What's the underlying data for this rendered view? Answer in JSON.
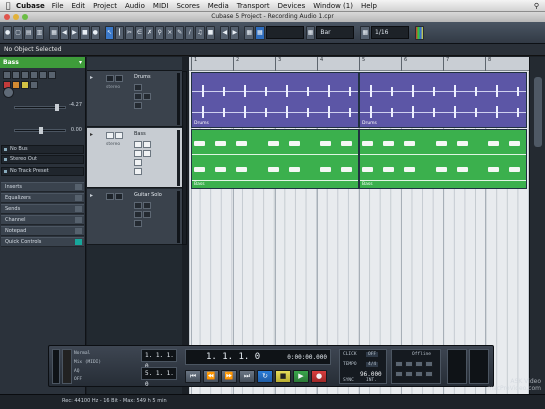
{
  "menubar": {
    "app_name": "Cubase",
    "items": [
      "File",
      "Edit",
      "Project",
      "Audio",
      "MIDI",
      "Scores",
      "Media",
      "Transport",
      "Devices",
      "Window (1)",
      "Help"
    ]
  },
  "window": {
    "title": "Cubase 5 Project - Recording Audio 1.cpr"
  },
  "toolbar": {
    "field_1": "Bar",
    "field_2": "1/16"
  },
  "statusline": {
    "text": "No Object Selected"
  },
  "inspector": {
    "track_name": "Bass",
    "volume": "-4.27",
    "pan": "0.00",
    "input_routing": "No Bus",
    "output_routing": "Stereo Out",
    "track_preset": "No Track Preset",
    "sections": [
      "Inserts",
      "Equalizers",
      "Sends",
      "Channel",
      "Notepad",
      "Quick Controls"
    ]
  },
  "tracks": [
    {
      "name": "Drums",
      "sub": "stereo"
    },
    {
      "name": "Bass",
      "sub": "stereo"
    },
    {
      "name": "Guitar Solo",
      "sub": ""
    }
  ],
  "ruler": {
    "bars": [
      "1",
      "2",
      "3",
      "4",
      "5",
      "6",
      "7",
      "8"
    ]
  },
  "events": [
    {
      "label": "Drums"
    },
    {
      "label": "Drums"
    },
    {
      "label": "Bass"
    },
    {
      "label": "Bass"
    }
  ],
  "transport": {
    "mode_1": "Normal",
    "mode_2": "Mix (MIDI)",
    "mode_3": "AQ",
    "mode_4": "OFF",
    "left_locator": "1. 1. 1. 0",
    "right_locator": "5. 1. 1. 0",
    "position_primary": "1. 1. 1.   0",
    "position_secondary": "0:00:00.000",
    "tempo_label": "TEMPO",
    "tempo_value": "96.000",
    "signature_value": "4/4",
    "sync_label": "SYNC",
    "sync_value": "INT.",
    "offline": "Offline",
    "click_label": "CLICK",
    "click_value": "OFF"
  },
  "bottom": {
    "rec_info": "Rec: 44100 Hz - 16 Bit - Max: 549 h 5 min"
  },
  "watermark": {
    "line1": "ASK Video",
    "line2": "macProVideo.com"
  }
}
